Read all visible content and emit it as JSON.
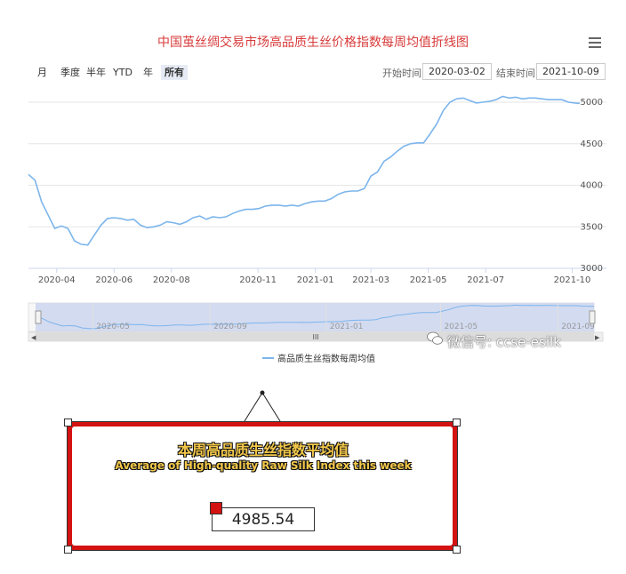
{
  "chart_data": {
    "type": "line",
    "title": "中国茧丝绸交易市场高品质生丝价格指数每周均值折线图",
    "ylim": [
      3000,
      5000
    ],
    "y_ticks": [
      "3000",
      "3500",
      "4000",
      "4500",
      "5000"
    ],
    "x_ticks": [
      "2020-04",
      "2020-06",
      "2020-08",
      "2020-11",
      "2021-01",
      "2021-03",
      "2021-05",
      "2021-07",
      "2021-10"
    ],
    "navigator_ticks": [
      "2020-05",
      "2020-09",
      "2021-01",
      "2021-05",
      "2021-09"
    ],
    "grid": true,
    "legend": "bottom-center",
    "series": [
      {
        "name": "高品质生丝指数每周均值",
        "color": "#7cb5ec",
        "x": [
          "2020-03-02",
          "2020-03-09",
          "2020-03-16",
          "2020-03-23",
          "2020-03-30",
          "2020-04-06",
          "2020-04-13",
          "2020-04-20",
          "2020-04-27",
          "2020-05-04",
          "2020-05-11",
          "2020-05-18",
          "2020-05-25",
          "2020-06-01",
          "2020-06-08",
          "2020-06-15",
          "2020-06-22",
          "2020-06-29",
          "2020-07-06",
          "2020-07-13",
          "2020-07-20",
          "2020-07-27",
          "2020-08-03",
          "2020-08-10",
          "2020-08-17",
          "2020-08-24",
          "2020-08-31",
          "2020-09-07",
          "2020-09-14",
          "2020-09-21",
          "2020-09-28",
          "2020-10-05",
          "2020-10-12",
          "2020-10-19",
          "2020-10-26",
          "2020-11-02",
          "2020-11-09",
          "2020-11-16",
          "2020-11-23",
          "2020-11-30",
          "2020-12-07",
          "2020-12-14",
          "2020-12-21",
          "2020-12-28",
          "2021-01-04",
          "2021-01-11",
          "2021-01-18",
          "2021-01-25",
          "2021-02-01",
          "2021-02-08",
          "2021-02-15",
          "2021-02-22",
          "2021-03-01",
          "2021-03-08",
          "2021-03-15",
          "2021-03-22",
          "2021-03-29",
          "2021-04-05",
          "2021-04-12",
          "2021-04-19",
          "2021-04-26",
          "2021-05-03",
          "2021-05-10",
          "2021-05-17",
          "2021-05-24",
          "2021-05-31",
          "2021-06-07",
          "2021-06-14",
          "2021-06-21",
          "2021-06-28",
          "2021-07-05",
          "2021-07-12",
          "2021-07-19",
          "2021-07-26",
          "2021-08-02",
          "2021-08-09",
          "2021-08-16",
          "2021-08-23",
          "2021-08-30",
          "2021-09-06",
          "2021-09-13",
          "2021-09-20",
          "2021-09-27",
          "2021-10-04",
          "2021-10-09"
        ],
        "values": [
          4130,
          4060,
          3800,
          3640,
          3480,
          3510,
          3480,
          3330,
          3290,
          3280,
          3400,
          3520,
          3600,
          3610,
          3600,
          3580,
          3590,
          3520,
          3490,
          3500,
          3520,
          3560,
          3550,
          3530,
          3560,
          3610,
          3630,
          3590,
          3620,
          3610,
          3620,
          3660,
          3690,
          3710,
          3710,
          3720,
          3750,
          3760,
          3760,
          3750,
          3760,
          3750,
          3780,
          3800,
          3810,
          3810,
          3840,
          3890,
          3920,
          3930,
          3930,
          3960,
          4110,
          4160,
          4290,
          4340,
          4410,
          4470,
          4500,
          4510,
          4510,
          4620,
          4740,
          4900,
          5000,
          5040,
          5050,
          5020,
          4990,
          5000,
          5010,
          5030,
          5070,
          5050,
          5060,
          5040,
          5050,
          5050,
          5040,
          5030,
          5030,
          5030,
          5000,
          4990,
          4985.54
        ]
      }
    ]
  },
  "range_buttons": {
    "month": "月",
    "quarter": "季度",
    "half_year": "半年",
    "ytd": "YTD",
    "year": "年",
    "all": "所有"
  },
  "date_range": {
    "start_label": "开始时间",
    "start_value": "2020-03-02",
    "end_label": "结束时间",
    "end_value": "2021-10-09"
  },
  "watermark": "微信号: ccse-esilk",
  "callout": {
    "title_cn": "本周高品质生丝指数平均值",
    "title_en": "Average of High-quality Raw Silk Index this week",
    "value": "4985.54"
  },
  "colors": {
    "title": "#d83b3b",
    "line": "#7cb5ec",
    "callout_frame": "#d31212",
    "callout_text": "#f3c84a"
  }
}
